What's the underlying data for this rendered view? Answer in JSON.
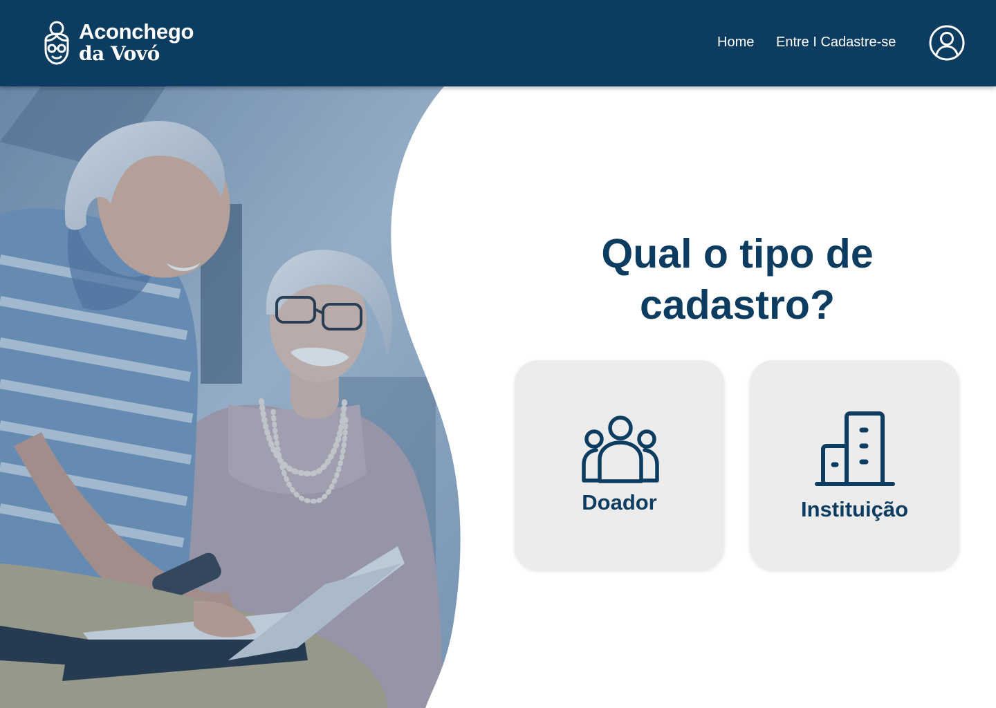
{
  "brand": {
    "line1": "Aconchego",
    "line2": "da Vovó",
    "logo_icon": "grandma-face-icon"
  },
  "nav": {
    "home": "Home",
    "login_signup": "Entre I Cadastre-se",
    "account_icon": "user-circle-icon"
  },
  "main": {
    "question": "Qual o tipo de cadastro?",
    "options": [
      {
        "label": "Doador",
        "icon": "people-group-icon"
      },
      {
        "label": "Instituição",
        "icon": "building-icon"
      }
    ]
  },
  "colors": {
    "primary": "#0d3c61",
    "card_bg": "#ececec",
    "background": "#ffffff"
  }
}
